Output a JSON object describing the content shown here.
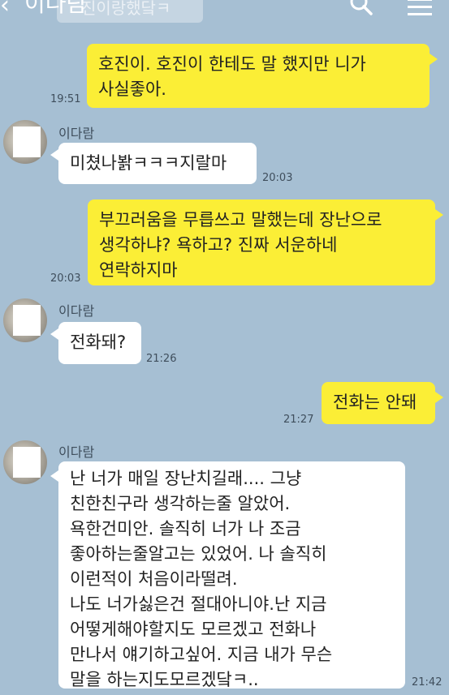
{
  "header": {
    "title": "이다람",
    "preview_text": "진이랑했닼ㅋ",
    "back_icon": "chevron-left-icon",
    "search_icon": "search-icon",
    "menu_icon": "hamburger-menu-icon"
  },
  "colors": {
    "background": "#a6bfd3",
    "my_bubble": "#fbee36",
    "other_bubble": "#ffffff"
  },
  "messages": [
    {
      "sender": "me",
      "text": "호진이. 호진이 한테도 말 했지만 니가\n사실좋아.",
      "time": "19:51"
    },
    {
      "sender": "other",
      "name": "이다람",
      "text": "미쳤나봙ㅋㅋㅋ지랄마",
      "time": "20:03"
    },
    {
      "sender": "me",
      "text": "부끄러움을 무릅쓰고 말했는데 장난으로\n생각하냐? 욕하고? 진짜 서운하네\n연락하지마",
      "time": "20:03"
    },
    {
      "sender": "other",
      "name": "이다람",
      "text": "전화돼?",
      "time": "21:26"
    },
    {
      "sender": "me",
      "text": "전화는 안돼",
      "time": "21:27"
    },
    {
      "sender": "other",
      "name": "이다람",
      "text": "난 너가 매일 장난치길래.... 그냥\n친한친구라 생각하는줄 알았어.\n욕한건미안. 솔직히 너가 나 조금\n좋아하는줄알고는 있었어. 나 솔직히\n이런적이 처음이라떨려.\n나도 너가싫은건 절대아니야.난 지금\n어떻게해야할지도 모르겠고 전화나\n만나서 얘기하고싶어. 지금 내가 무슨\n말을 하는지도모르겠닼ㅋ..",
      "time": "21:42"
    }
  ]
}
